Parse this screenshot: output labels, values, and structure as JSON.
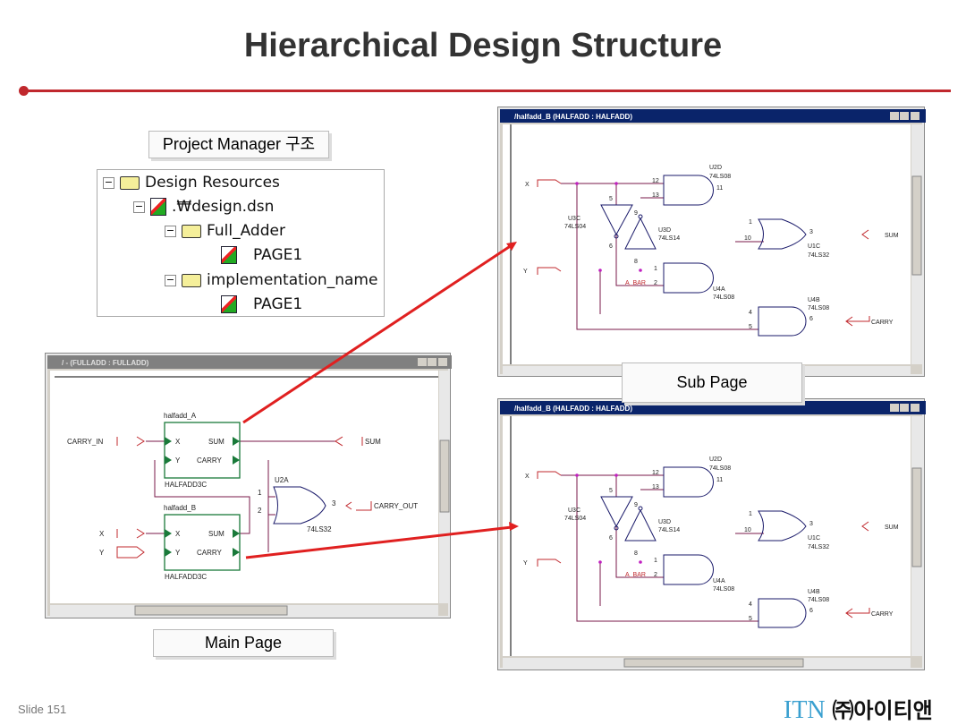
{
  "slide": {
    "title": "Hierarchical Design Structure",
    "footer": "Slide 151",
    "logo_text": "ITN",
    "logo_korean": "㈜아이티앤",
    "accent": "#c0282d"
  },
  "labels": {
    "project_manager": "Project Manager 구조",
    "main_page": "Main Page",
    "sub_page": "Sub Page"
  },
  "tree": {
    "items": [
      {
        "label": "Design Resources",
        "expanded": true,
        "icon": "folder-icon"
      },
      {
        "label": ".₩design.dsn",
        "expanded": true,
        "icon": "design-file-icon"
      },
      {
        "label": "Full_Adder",
        "expanded": true,
        "icon": "root-folder-icon"
      },
      {
        "label": "PAGE1",
        "icon": "schematic-page-icon"
      },
      {
        "label": "implementation_name",
        "expanded": true,
        "icon": "folder-icon"
      },
      {
        "label": "PAGE1",
        "icon": "schematic-page-icon"
      }
    ]
  },
  "main_window": {
    "title": "/ - (FULLADD : FULLADD)",
    "parts": {
      "a_ref": "halfadd_A",
      "b_ref": "halfadd_B",
      "block_name": "HALFADD3C",
      "pin_x": "X",
      "pin_y": "Y",
      "pin_sum": "SUM",
      "pin_carry": "CARRY",
      "or_ref": "U2A",
      "or_type": "74LS32",
      "pin1": "1",
      "pin2": "2",
      "pin3": "3"
    },
    "ports": {
      "carry_in": "CARRY_IN",
      "x": "X",
      "y": "Y",
      "sum": "SUM",
      "carry_out": "CARRY_OUT"
    }
  },
  "sub_window": {
    "title": "/halfadd_B   (HALFADD : HALFADD)",
    "parts": {
      "u2d": "U2D",
      "u2d_type": "74LS08",
      "u3c": "U3C",
      "u3c_type": "74LS04",
      "u3d": "U3D",
      "u3d_type": "74LS14",
      "u1c": "U1C",
      "u1c_type": "74LS32",
      "u4a": "U4A",
      "u4a_type": "74LS08",
      "u4b": "U4B",
      "u4b_type": "74LS08",
      "a_bar": "A_BAR",
      "p12": "12",
      "p13": "13",
      "p11": "11",
      "p5": "5",
      "p6": "6",
      "p9": "9",
      "p8": "8",
      "p1": "1",
      "p2": "2",
      "p3": "3",
      "p4": "4",
      "p10": "10"
    },
    "ports": {
      "x": "X",
      "y": "Y",
      "sum": "SUM",
      "carry": "CARRY"
    }
  },
  "colors": {
    "wire": "#7a1a4a",
    "port": "#c0282d",
    "part": "#1a1a6a",
    "block": "#1a7a3a",
    "titlebar": "#0a246a"
  }
}
